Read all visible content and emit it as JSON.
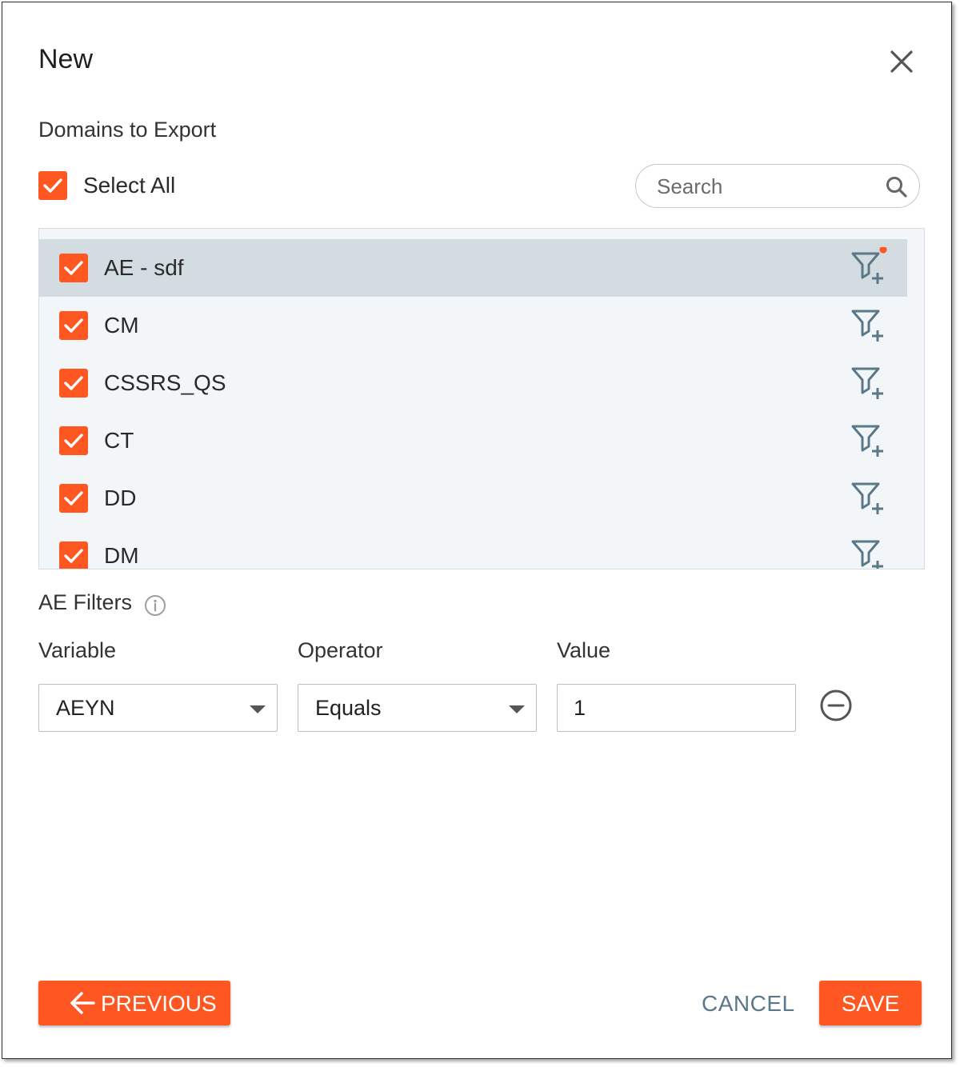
{
  "dialog": {
    "title": "New"
  },
  "domains": {
    "section_label": "Domains to Export",
    "select_all_label": "Select All",
    "select_all_checked": true,
    "search_placeholder": "Search",
    "items": [
      {
        "label": "AE - sdf",
        "checked": true,
        "selected": true,
        "has_filter": true
      },
      {
        "label": "CM",
        "checked": true,
        "selected": false,
        "has_filter": false
      },
      {
        "label": "CSSRS_QS",
        "checked": true,
        "selected": false,
        "has_filter": false
      },
      {
        "label": "CT",
        "checked": true,
        "selected": false,
        "has_filter": false
      },
      {
        "label": "DD",
        "checked": true,
        "selected": false,
        "has_filter": false
      },
      {
        "label": "DM",
        "checked": true,
        "selected": false,
        "has_filter": false
      }
    ]
  },
  "filters": {
    "title": "AE Filters",
    "variable_label": "Variable",
    "operator_label": "Operator",
    "value_label": "Value",
    "variable_value": "AEYN",
    "operator_value": "Equals",
    "value_value": "1"
  },
  "footer": {
    "previous_label": "PREVIOUS",
    "cancel_label": "CANCEL",
    "save_label": "SAVE"
  },
  "colors": {
    "accent": "#ff5722",
    "selected_row": "#d3dce1",
    "filter_icon": "#5a7888"
  }
}
